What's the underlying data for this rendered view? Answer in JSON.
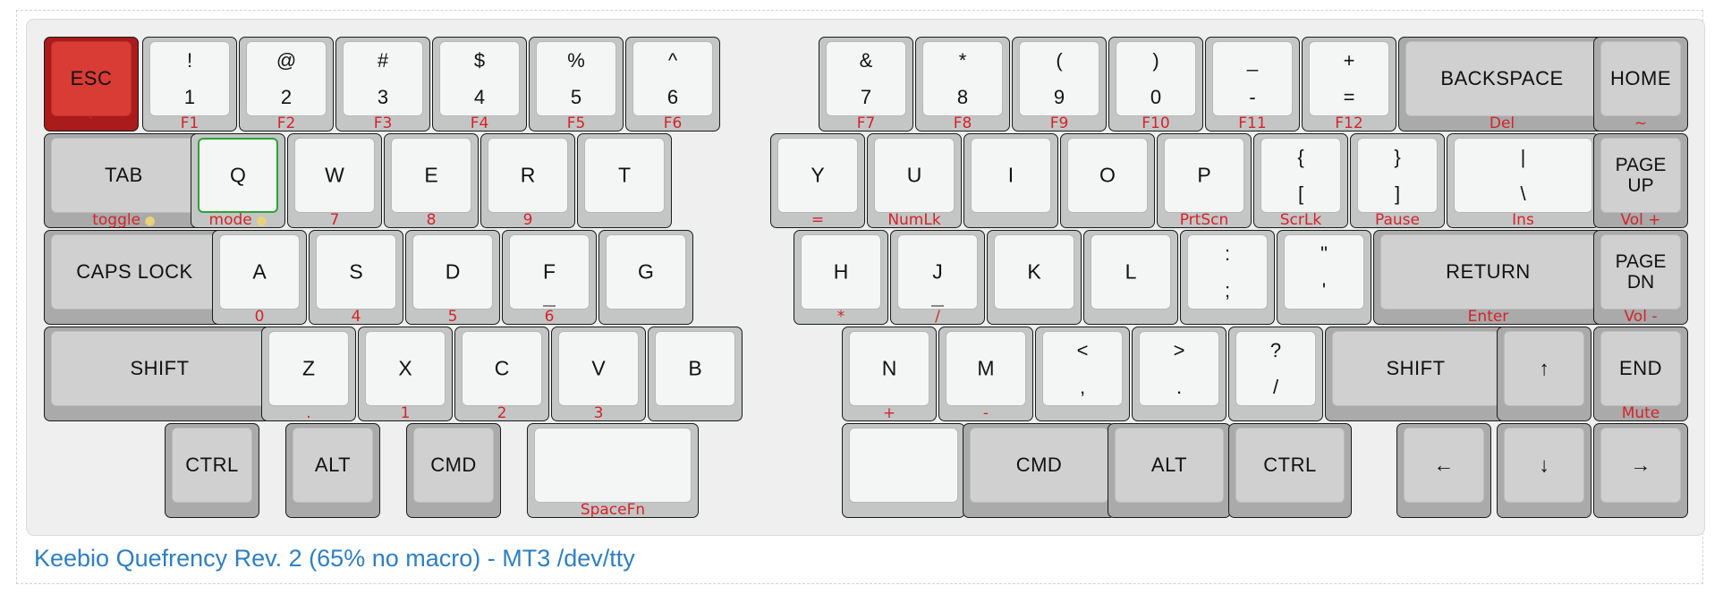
{
  "caption": "Keebio Quefrency Rev. 2 (65% no macro) - MT3 /dev/tty",
  "colors": {
    "legend": "#111111",
    "sublegend": "#d3242a",
    "alpha_keycap": "#f3f6f4",
    "modifier_keycap": "#d0d0d0",
    "esc_keycap": "#d93b35",
    "selected_outline": "#2ea23c",
    "caption": "#2f7fc1"
  },
  "rows": [
    {
      "name": "number-row",
      "keys": [
        {
          "id": "esc",
          "style": "esc",
          "center": "ESC",
          "sub": "`"
        },
        {
          "id": "1",
          "top": "!",
          "bottom": "1",
          "sub": "F1"
        },
        {
          "id": "2",
          "top": "@",
          "bottom": "2",
          "sub": "F2"
        },
        {
          "id": "3",
          "top": "#",
          "bottom": "3",
          "sub": "F3"
        },
        {
          "id": "4",
          "top": "$",
          "bottom": "4",
          "sub": "F4"
        },
        {
          "id": "5",
          "top": "%",
          "bottom": "5",
          "sub": "F5"
        },
        {
          "id": "6",
          "top": "^",
          "bottom": "6",
          "sub": "F6"
        },
        {
          "id": "7",
          "top": "&",
          "bottom": "7",
          "sub": "F7"
        },
        {
          "id": "8",
          "top": "*",
          "bottom": "8",
          "sub": "F8"
        },
        {
          "id": "9",
          "top": "(",
          "bottom": "9",
          "sub": "F9"
        },
        {
          "id": "0",
          "top": ")",
          "bottom": "0",
          "sub": "F10"
        },
        {
          "id": "minus",
          "top": "_",
          "bottom": "-",
          "sub": "F11"
        },
        {
          "id": "equals",
          "top": "+",
          "bottom": "=",
          "sub": "F12"
        },
        {
          "id": "backspace",
          "style": "mod",
          "center": "BACKSPACE",
          "sub": "Del"
        },
        {
          "id": "home",
          "style": "mod",
          "center": "HOME",
          "sub": "~"
        }
      ]
    },
    {
      "name": "top-row",
      "keys": [
        {
          "id": "tab",
          "style": "mod",
          "center": "TAB",
          "sub": "toggle",
          "bulb": true
        },
        {
          "id": "q",
          "center": "Q",
          "sub": "mode",
          "bulb": true,
          "selected": true
        },
        {
          "id": "w",
          "center": "W",
          "sub": "7"
        },
        {
          "id": "e",
          "center": "E",
          "sub": "8"
        },
        {
          "id": "r",
          "center": "R",
          "sub": "9"
        },
        {
          "id": "t",
          "center": "T",
          "sub": ""
        },
        {
          "id": "y",
          "center": "Y",
          "sub": "="
        },
        {
          "id": "u",
          "center": "U",
          "sub": "NumLk"
        },
        {
          "id": "i",
          "center": "I",
          "sub": ""
        },
        {
          "id": "o",
          "center": "O",
          "sub": ""
        },
        {
          "id": "p",
          "center": "P",
          "sub": "PrtScn"
        },
        {
          "id": "lbracket",
          "top": "{",
          "bottom": "[",
          "sub": "ScrLk"
        },
        {
          "id": "rbracket",
          "top": "}",
          "bottom": "]",
          "sub": "Pause"
        },
        {
          "id": "backslash",
          "top": "|",
          "bottom": "\\",
          "sub": "Ins"
        },
        {
          "id": "pageup",
          "style": "mod",
          "center": "PAGE\nUP",
          "sub": "Vol +"
        }
      ]
    },
    {
      "name": "home-row",
      "keys": [
        {
          "id": "capslock",
          "style": "mod",
          "center": "CAPS LOCK",
          "sub": ""
        },
        {
          "id": "a",
          "center": "A",
          "sub": "0"
        },
        {
          "id": "s",
          "center": "S",
          "sub": "4"
        },
        {
          "id": "d",
          "center": "D",
          "sub": "5"
        },
        {
          "id": "f",
          "center": "F",
          "sub": "6",
          "bump": true
        },
        {
          "id": "g",
          "center": "G",
          "sub": ""
        },
        {
          "id": "h",
          "center": "H",
          "sub": "*"
        },
        {
          "id": "j",
          "center": "J",
          "sub": "/",
          "bump": true
        },
        {
          "id": "k",
          "center": "K",
          "sub": ""
        },
        {
          "id": "l",
          "center": "L",
          "sub": ""
        },
        {
          "id": "semicolon",
          "top": ":",
          "bottom": ";",
          "sub": ""
        },
        {
          "id": "quote",
          "top": "\"",
          "bottom": "'",
          "sub": ""
        },
        {
          "id": "return",
          "style": "mod",
          "center": "RETURN",
          "sub": "Enter"
        },
        {
          "id": "pagedn",
          "style": "mod",
          "center": "PAGE\nDN",
          "sub": "Vol -"
        }
      ]
    },
    {
      "name": "bottom-row",
      "keys": [
        {
          "id": "lshift",
          "style": "mod",
          "center": "SHIFT",
          "sub": ""
        },
        {
          "id": "z",
          "center": "Z",
          "sub": "."
        },
        {
          "id": "x",
          "center": "X",
          "sub": "1"
        },
        {
          "id": "c",
          "center": "C",
          "sub": "2"
        },
        {
          "id": "v",
          "center": "V",
          "sub": "3"
        },
        {
          "id": "b",
          "center": "B",
          "sub": ""
        },
        {
          "id": "n",
          "center": "N",
          "sub": "+"
        },
        {
          "id": "m",
          "center": "M",
          "sub": "-"
        },
        {
          "id": "comma",
          "top": "<",
          "bottom": ",",
          "sub": ""
        },
        {
          "id": "period",
          "top": ">",
          "bottom": ".",
          "sub": ""
        },
        {
          "id": "slash",
          "top": "?",
          "bottom": "/",
          "sub": ""
        },
        {
          "id": "rshift",
          "style": "mod",
          "center": "SHIFT",
          "sub": ""
        },
        {
          "id": "up",
          "style": "mod",
          "center": "↑",
          "sub": ""
        },
        {
          "id": "end",
          "style": "mod",
          "center": "END",
          "sub": "Mute"
        }
      ]
    },
    {
      "name": "space-row",
      "keys": [
        {
          "id": "lctrl",
          "style": "mod",
          "center": "CTRL",
          "sub": ""
        },
        {
          "id": "lalt",
          "style": "mod",
          "center": "ALT",
          "sub": ""
        },
        {
          "id": "lcmd",
          "style": "mod",
          "center": "CMD",
          "sub": ""
        },
        {
          "id": "lspace",
          "center": "",
          "sub": "SpaceFn"
        },
        {
          "id": "rspace",
          "center": "",
          "sub": ""
        },
        {
          "id": "rcmd",
          "style": "mod",
          "center": "CMD",
          "sub": ""
        },
        {
          "id": "ralt",
          "style": "mod",
          "center": "ALT",
          "sub": ""
        },
        {
          "id": "rctrl",
          "style": "mod",
          "center": "CTRL",
          "sub": ""
        },
        {
          "id": "left",
          "style": "mod",
          "center": "←",
          "sub": ""
        },
        {
          "id": "down",
          "style": "mod",
          "center": "↓",
          "sub": ""
        },
        {
          "id": "right",
          "style": "mod",
          "center": "→",
          "sub": ""
        }
      ]
    }
  ]
}
